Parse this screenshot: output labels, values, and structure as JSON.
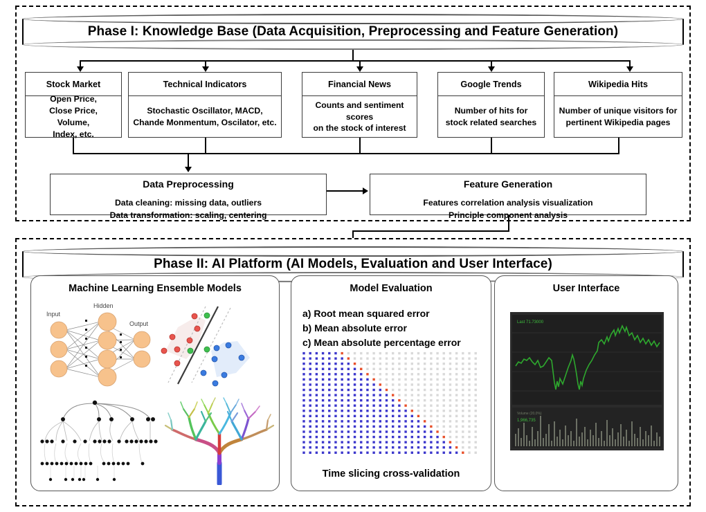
{
  "phase1": {
    "banner_title": "Phase I: Knowledge Base (Data Acquisition, Preprocessing and Feature Generation)",
    "sources": [
      {
        "title": "Stock Market",
        "detail": "Open Price,\nClose Price,\nVolume,\nIndex, etc."
      },
      {
        "title": "Technical Indicators",
        "detail": "Stochastic Oscillator, MACD,\nChande Monmentum, Oscilator, etc."
      },
      {
        "title": "Financial News",
        "detail": "Counts and sentiment scores\non the stock of interest"
      },
      {
        "title": "Google Trends",
        "detail": "Number of hits for\nstock related searches"
      },
      {
        "title": "Wikipedia Hits",
        "detail": "Number of unique visitors for\npertinent Wikipedia pages"
      }
    ],
    "preprocessing": {
      "title": "Data Preprocessing",
      "lines": "Data cleaning: missing data, outliers\nData transformation: scaling, centering"
    },
    "feature_generation": {
      "title": "Feature Generation",
      "lines": "Features correlation analysis visualization\nPrinciple component analysis"
    }
  },
  "phase2": {
    "banner_title": "Phase II: AI Platform (AI Models, Evaluation and User Interface)",
    "panels": [
      {
        "title": "Machine Learning Ensemble Models"
      },
      {
        "title": "Model Evaluation"
      },
      {
        "title": "User Interface"
      }
    ],
    "ml_diagram": {
      "nn_labels": {
        "input": "Input",
        "hidden": "Hidden",
        "output": "Output"
      },
      "nn_node_color": "#F7C28C",
      "svm_red": "#E8554E",
      "svm_blue": "#3A7BE0",
      "svm_green": "#3FBF4F",
      "tree_node_color": "#111111"
    },
    "evaluation": {
      "metrics": [
        "a) Root mean squared error",
        "b) Mean absolute error",
        "c) Mean absolute percentage error"
      ],
      "cv_caption": "Time slicing cross-validation",
      "cv_plot": {
        "rows": 20,
        "cols": 28,
        "train_color": "#3B36CC",
        "test_color": "#E8502A",
        "unused_color": "#D9D9D9"
      }
    },
    "user_interface": {
      "price_label": "Last 71.73000",
      "volume_label": "Volume (20,0%)",
      "volume_value": "1,966,735",
      "line_color": "#2EA82E",
      "background": "#1C1C1C"
    }
  }
}
